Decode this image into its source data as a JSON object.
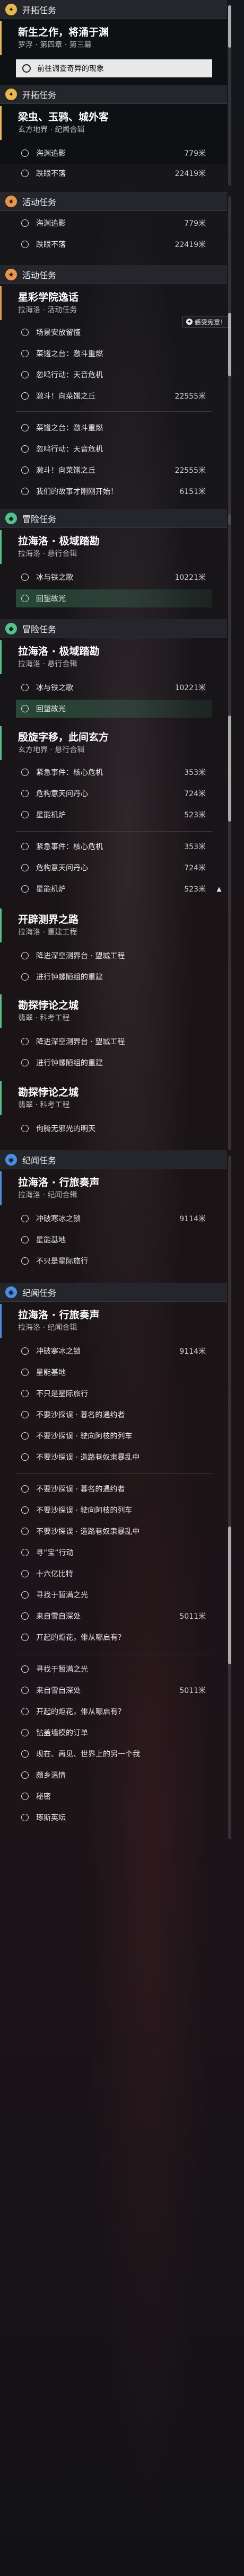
{
  "sections": [
    {
      "label": "开拓任务",
      "color": "#e8b84a"
    },
    {
      "label": "开拓任务",
      "color": "#e8b84a"
    },
    {
      "label": "活动任务",
      "color": "#e8974a"
    },
    {
      "label": "活动任务",
      "color": "#e8974a"
    },
    {
      "label": "冒险任务",
      "color": "#4ec48a"
    },
    {
      "label": "冒险任务",
      "color": "#4ec48a"
    },
    {
      "label": "纪闻任务",
      "color": "#4a8fe8"
    },
    {
      "label": "纪闻任务",
      "color": "#4a8fe8"
    }
  ],
  "quests": {
    "main1": {
      "title": "新生之作，将涌于渊",
      "sub": "罗浮 · 第四章 · 第三幕"
    },
    "main1_nav": "前往调查奇异的现象",
    "main2": {
      "title": "梁虫、玉鸦、城外客",
      "sub": "玄方地界 · 纪闻合辑"
    },
    "sky": {
      "title": "星彩学院逸话",
      "sub": "拉海洛 · 活动任务"
    },
    "adv1": {
      "title": "拉海洛 · 极域踏勘",
      "sub": "拉海洛 · 悬行合辑"
    },
    "adv2": {
      "title": "拉海洛 · 极域踏勘",
      "sub": "拉海洛 · 悬行合辑"
    },
    "adv3": {
      "title": "殷旋字移，此间玄方",
      "sub": "玄方地界 · 悬行合辑"
    },
    "adv4": {
      "title": "开辟测界之路",
      "sub": "拉海洛 · 重建工程"
    },
    "adv5": {
      "title": "勘探悖论之城",
      "sub": "翡翠 · 科考工程"
    },
    "adv6": {
      "title": "勘探悖论之城",
      "sub": "翡翠 · 科考工程"
    },
    "log1": {
      "title": "拉海洛 · 行旅奏声",
      "sub": "拉海洛 · 纪闻合辑"
    },
    "log2": {
      "title": "拉海洛 · 行旅奏声",
      "sub": "拉海洛 · 纪闻合辑"
    }
  },
  "tasks": {
    "t1": "海渊追影",
    "t1d": "779米",
    "t2": "跌眼不落",
    "t2d": "22419米",
    "t3": "海渊追影",
    "t3d": "779米",
    "t4": "跌眼不落",
    "t4d": "22419米",
    "t5": "场景安放留懂",
    "t6": "菜馐之台：激斗重燃",
    "t7": "忽鸣行动：天音危机",
    "t8": "激斗！向菜馐之丘",
    "t8d": "22555米",
    "t9": "菜馐之台：激斗重燃",
    "t10": "忽鸣行动：天音危机",
    "t11": "激斗！向菜馐之丘",
    "t11d": "22555米",
    "t12": "我们的故事才刚刚开始！",
    "t12d": "6151米",
    "t13": "冰与铁之歌",
    "t13d": "10221米",
    "t14": "回望故光",
    "t15": "冰与铁之歌",
    "t15d": "10221米",
    "t16": "回望故光",
    "t17": "紧急事件：核心危机",
    "t17d": "353米",
    "t18": "危构意天问丹心",
    "t18d": "724米",
    "t19": "星能机炉",
    "t19d": "523米",
    "t20": "紧急事件：核心危机",
    "t20d": "353米",
    "t21": "危构意天问丹心",
    "t21d": "724米",
    "t22": "星能机炉",
    "t22d": "523米",
    "t23": "降进深空测界台 · 望城工程",
    "t24": "进行钟螺陋组的重建",
    "t25": "降进深空测界台 · 望城工程",
    "t26": "进行钟螺陋组的重建",
    "t27": "佝腾无邪光的明天",
    "t28": "冲破寒冰之锁",
    "t28d": "9114米",
    "t29": "星能基地",
    "t30": "不只是星际旅行",
    "t31": "冲破寒冰之锁",
    "t31d": "9114米",
    "t32": "星能基地",
    "t33": "不只是星际旅行",
    "t34": "不要沙探误 · 暮名的遇约者",
    "t35": "不要沙探误 · 驶向阿枝的列车",
    "t36": "不要沙探误 · 造路巷奴隶暴乱中",
    "t37": "不要沙探误 · 暮名的遇约者",
    "t38": "不要沙探误 · 驶向阿枝的列车",
    "t39": "不要沙探误 · 造路巷奴隶暴乱中",
    "t40": "寻“宝”行动",
    "t41": "十六亿比特",
    "t42": "寻找于暂满之光",
    "t43": "来自雪自深处",
    "t43d": "5011米",
    "t44": "开起的炬花，俳从哪启有？",
    "t45": "寻找于暂满之光",
    "t46": "来自雪自深处",
    "t46d": "5011米",
    "t47": "开起的炬花，俳从哪启有？",
    "t48": "钻盖墙模的订单",
    "t49": "现在、再见、世界上的另一个我",
    "t50": "颇乡温情",
    "t51": "秘密",
    "t52": "琢斯英坛"
  },
  "badge": {
    "label": "感受宪意！"
  },
  "colors": {
    "main": "#e8b84a",
    "event": "#e8974a",
    "adventure": "#4ec48a",
    "log": "#4a8fe8"
  }
}
